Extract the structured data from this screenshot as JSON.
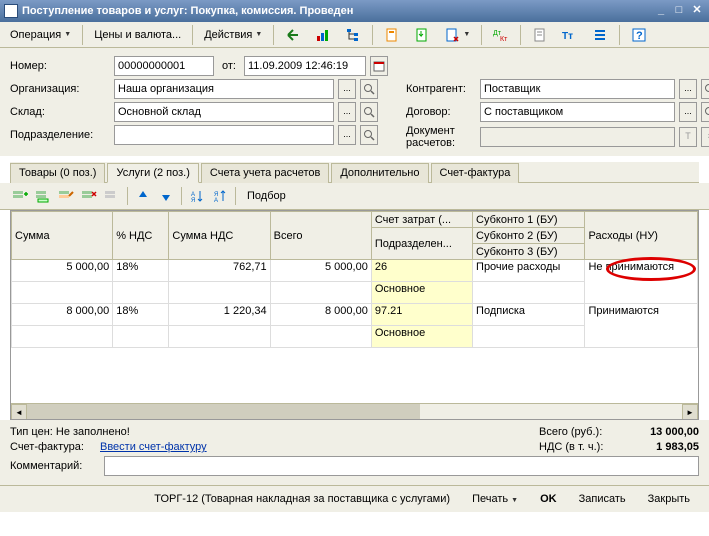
{
  "window": {
    "title": "Поступление товаров и услуг: Покупка, комиссия. Проведен"
  },
  "menubar": {
    "operation": "Операция",
    "prices": "Цены и валюта...",
    "actions": "Действия"
  },
  "form": {
    "number_label": "Номер:",
    "number": "00000000001",
    "from_label": "от:",
    "date": "11.09.2009 12:46:19",
    "org_label": "Организация:",
    "org": "Наша организация",
    "warehouse_label": "Склад:",
    "warehouse": "Основной склад",
    "dept_label": "Подразделение:",
    "dept": "",
    "contractor_label": "Контрагент:",
    "contractor": "Поставщик",
    "contract_label": "Договор:",
    "contract": "С поставщиком",
    "doc_calc_label": "Документ расчетов:",
    "doc_calc": ""
  },
  "tabs": {
    "goods": "Товары (0 поз.)",
    "services": "Услуги (2 поз.)",
    "accounts": "Счета учета расчетов",
    "additional": "Дополнительно",
    "invoice": "Счет-фактура"
  },
  "tab_toolbar": {
    "podbor": "Подбор"
  },
  "grid": {
    "headers": {
      "sum": "Сумма",
      "vat_pct": "% НДС",
      "vat_sum": "Сумма НДС",
      "total": "Всего",
      "cost_acc": "Счет затрат (...",
      "subdept": "Подразделен...",
      "sub1": "Субконто 1 (БУ)",
      "sub2": "Субконто 2 (БУ)",
      "sub3": "Субконто 3 (БУ)",
      "exp_nu": "Расходы (НУ)"
    },
    "rows": [
      {
        "sum": "5 000,00",
        "vat_pct": "18%",
        "vat_sum": "762,71",
        "total": "5 000,00",
        "cost_acc": "26",
        "dept": "Основное",
        "sub1": "Прочие расходы",
        "exp_nu": "Не принимаются"
      },
      {
        "sum": "8 000,00",
        "vat_pct": "18%",
        "vat_sum": "1 220,34",
        "total": "8 000,00",
        "cost_acc": "97.21",
        "dept": "Основное",
        "sub1": "Подписка",
        "exp_nu": "Принимаются"
      }
    ]
  },
  "summary": {
    "price_type_label": "Тип цен: Не заполнено!",
    "invoice_label": "Счет-фактура:",
    "invoice_link": "Ввести счет-фактуру",
    "comment_label": "Комментарий:",
    "total_label": "Всего (руб.):",
    "total_value": "13 000,00",
    "vat_label": "НДС (в т. ч.):",
    "vat_value": "1 983,05"
  },
  "bottombar": {
    "torg12": "ТОРГ-12 (Товарная накладная за поставщика с услугами)",
    "print": "Печать",
    "ok": "OK",
    "save": "Записать",
    "close": "Закрыть"
  }
}
